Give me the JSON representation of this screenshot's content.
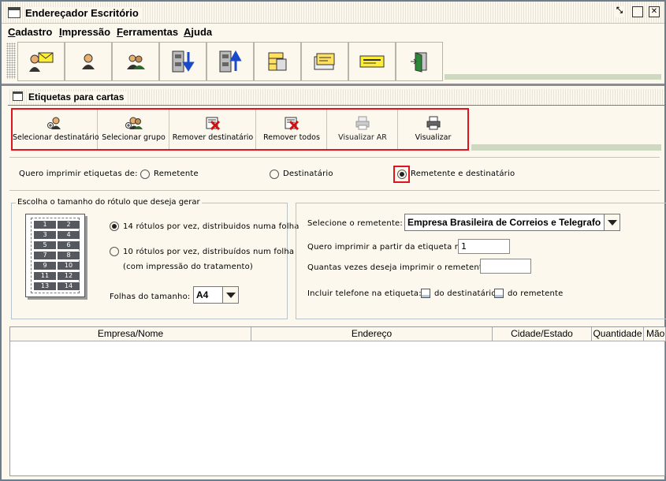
{
  "window": {
    "title": "Endereçador Escritório",
    "controls": [
      "restore",
      "maximize",
      "close"
    ]
  },
  "menu": [
    "Cadastro",
    "Impressão",
    "Ferramentas",
    "Ajuda"
  ],
  "toolbar": {
    "icons": [
      "mail-user-icon",
      "user-icon",
      "group-icon",
      "import-icon",
      "export-icon",
      "database-icon",
      "card-index-icon",
      "envelope-icon",
      "exit-door-icon"
    ]
  },
  "frame": {
    "title": "Etiquetas para cartas"
  },
  "actions": [
    {
      "label": "Selecionar destinatário",
      "icon": "add-user-icon"
    },
    {
      "label": "Selecionar grupo",
      "icon": "add-group-icon"
    },
    {
      "label": "Remover destinatário",
      "icon": "remove-user-icon"
    },
    {
      "label": "Remover todos",
      "icon": "remove-all-icon"
    },
    {
      "label": "Visualizar AR",
      "icon": "printer-disabled-icon"
    },
    {
      "label": "Visualizar",
      "icon": "printer-icon"
    }
  ],
  "print_mode": {
    "label": "Quero imprimir etiquetas de:",
    "options": [
      "Remetente",
      "Destinatário",
      "Remetente e destinatário"
    ],
    "selected": "Remetente e destinatário"
  },
  "size_group": {
    "legend": "Escolha o tamanho do rótulo que deseja gerar",
    "sheet_numbers": [
      "1",
      "2",
      "3",
      "4",
      "5",
      "6",
      "7",
      "8",
      "9",
      "10",
      "11",
      "12",
      "13",
      "14"
    ],
    "option14": "14 rótulos por vez, distribuidos numa folha",
    "option10_line1": "10 rótulos por vez, distribuídos num folha",
    "option10_line2": "(com impressão do tratamento)",
    "selected": "14",
    "paper_label": "Folhas do tamanho:",
    "paper_value": "A4"
  },
  "sender_panel": {
    "sender_label": "Selecione o remetente:",
    "sender_value": "Empresa Brasileira de Correios e Telegrafo",
    "start_label": "Quero imprimir a partir da etiqueta nº:",
    "start_value": "1",
    "times_label": "Quantas vezes deseja imprimir o remetente:",
    "times_value": "",
    "phone_label": "Incluir telefone na etiqueta:",
    "phone_dest": "do destinatário",
    "phone_sender": "do remetente"
  },
  "table": {
    "columns": [
      "Empresa/Nome",
      "Endereço",
      "Cidade/Estado",
      "Quantidade",
      "Mão"
    ]
  }
}
